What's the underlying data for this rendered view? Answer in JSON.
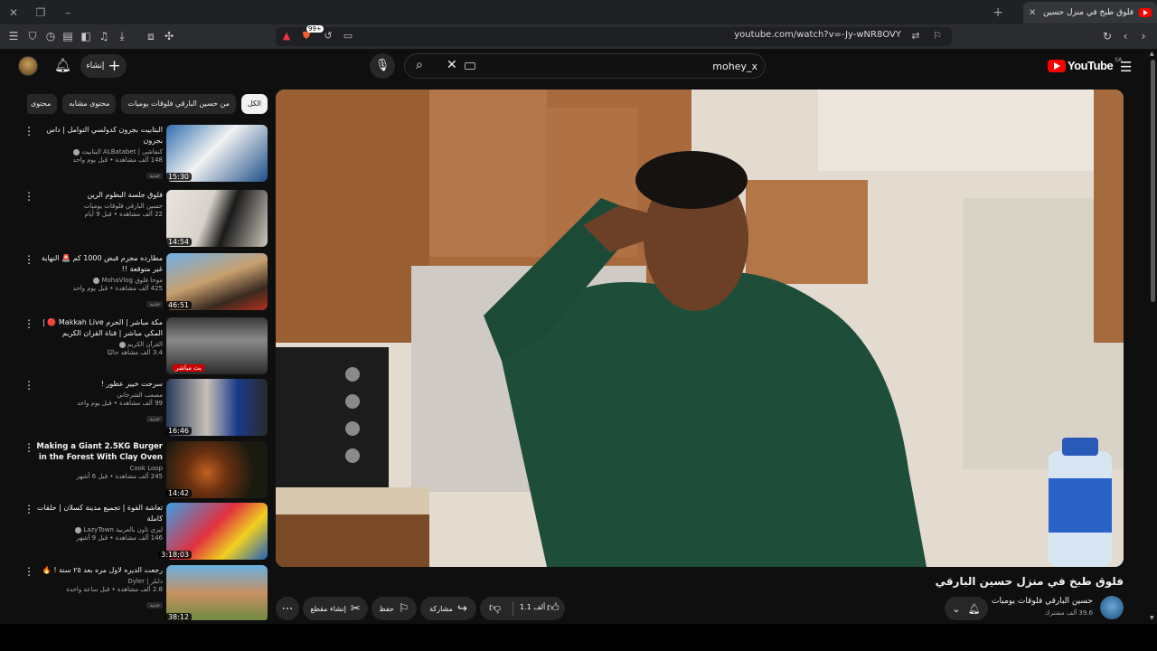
{
  "browser": {
    "tab_title": "فلوق طبخ في منزل حسين البارقي",
    "url": "youtube.com/watch?v=-Jy-wNR8OVY",
    "extension_badge": "99+"
  },
  "header": {
    "create_label": "إنشاء",
    "search_value": "mohey_x",
    "logo_text": "YouTube",
    "country_code": "SA"
  },
  "chips": [
    "الكل",
    "من حسين البارقي فلوقات يوميات",
    "محتوى مشابه",
    "محتوى"
  ],
  "recommendations": [
    {
      "title": "البتابيت بجرون كدولسي التوامل | داس بجرون",
      "channel": "كنفاشي | ALBatabet البتابيت",
      "meta": "148 ألف مشاهدة • قبل يوم واحد",
      "new": "جديد",
      "duration": "15:30",
      "ltr": false
    },
    {
      "title": "فلوق جلسة البطوم الرين",
      "channel": "حسين البارقي فلوقات يوميات",
      "meta": "22 ألف مشاهدة • قبل 9 أيام",
      "new": "",
      "duration": "14:54",
      "ltr": false
    },
    {
      "title": "مطارده مجرم قبض 1000 كم 🚨 النهاية غير متوقعة !!",
      "channel": "موحا فلوق MohaVlog",
      "meta": "425 ألف مشاهدة • قبل يوم واحد",
      "new": "جديد",
      "duration": "46:51",
      "ltr": false
    },
    {
      "title": "مكة مباشر | الحرم Makkah Live 🔴 | المكي مباشر | قناة القران الكريم السعودية ...",
      "channel": "القرآن الكريم",
      "meta": "3.4 ألف مشاهد حاليًا",
      "new": "",
      "duration": "بث مباشر",
      "ltr": false
    },
    {
      "title": "سرحت خيير عطور !",
      "channel": "مصعب الشرجاني",
      "meta": "99 ألف مشاهدة • قبل يوم واحد",
      "new": "جديد",
      "duration": "16:46",
      "ltr": false
    },
    {
      "title": "Making a Giant 2.5KG Burger in the Forest With Clay Oven and...",
      "channel": "Cook Loop",
      "meta": "245 ألف مشاهدة • قبل 6 أشهر",
      "new": "",
      "duration": "14:42",
      "ltr": true
    },
    {
      "title": "تعاشة القوة | تجميع مدينة كسلان | حلقات كاملة",
      "channel": "ليزي تاون بالعربية LazyTown",
      "meta": "146 ألف مشاهدة • قبل 9 أشهر",
      "new": "",
      "duration": "3:18:03",
      "ltr": false
    },
    {
      "title": "رجعت الديره لاول مره بعد ٢٥ سنة ! 🔥",
      "channel": "دايلر | Dyler",
      "meta": "2.8 ألف مشاهدة • قبل ساعة واحدة",
      "new": "جديد",
      "duration": "38:12",
      "ltr": false
    }
  ],
  "video": {
    "title": "فلوق طبخ في منزل حسين البارقي",
    "channel": "حسين البارقي فلوقات يوميات",
    "subscribers": "39.6 ألف مشترك"
  },
  "actions": {
    "like_count": "1.1 ألف",
    "share": "مشاركة",
    "save": "حفظ",
    "clip": "إنشاء مقطع"
  }
}
